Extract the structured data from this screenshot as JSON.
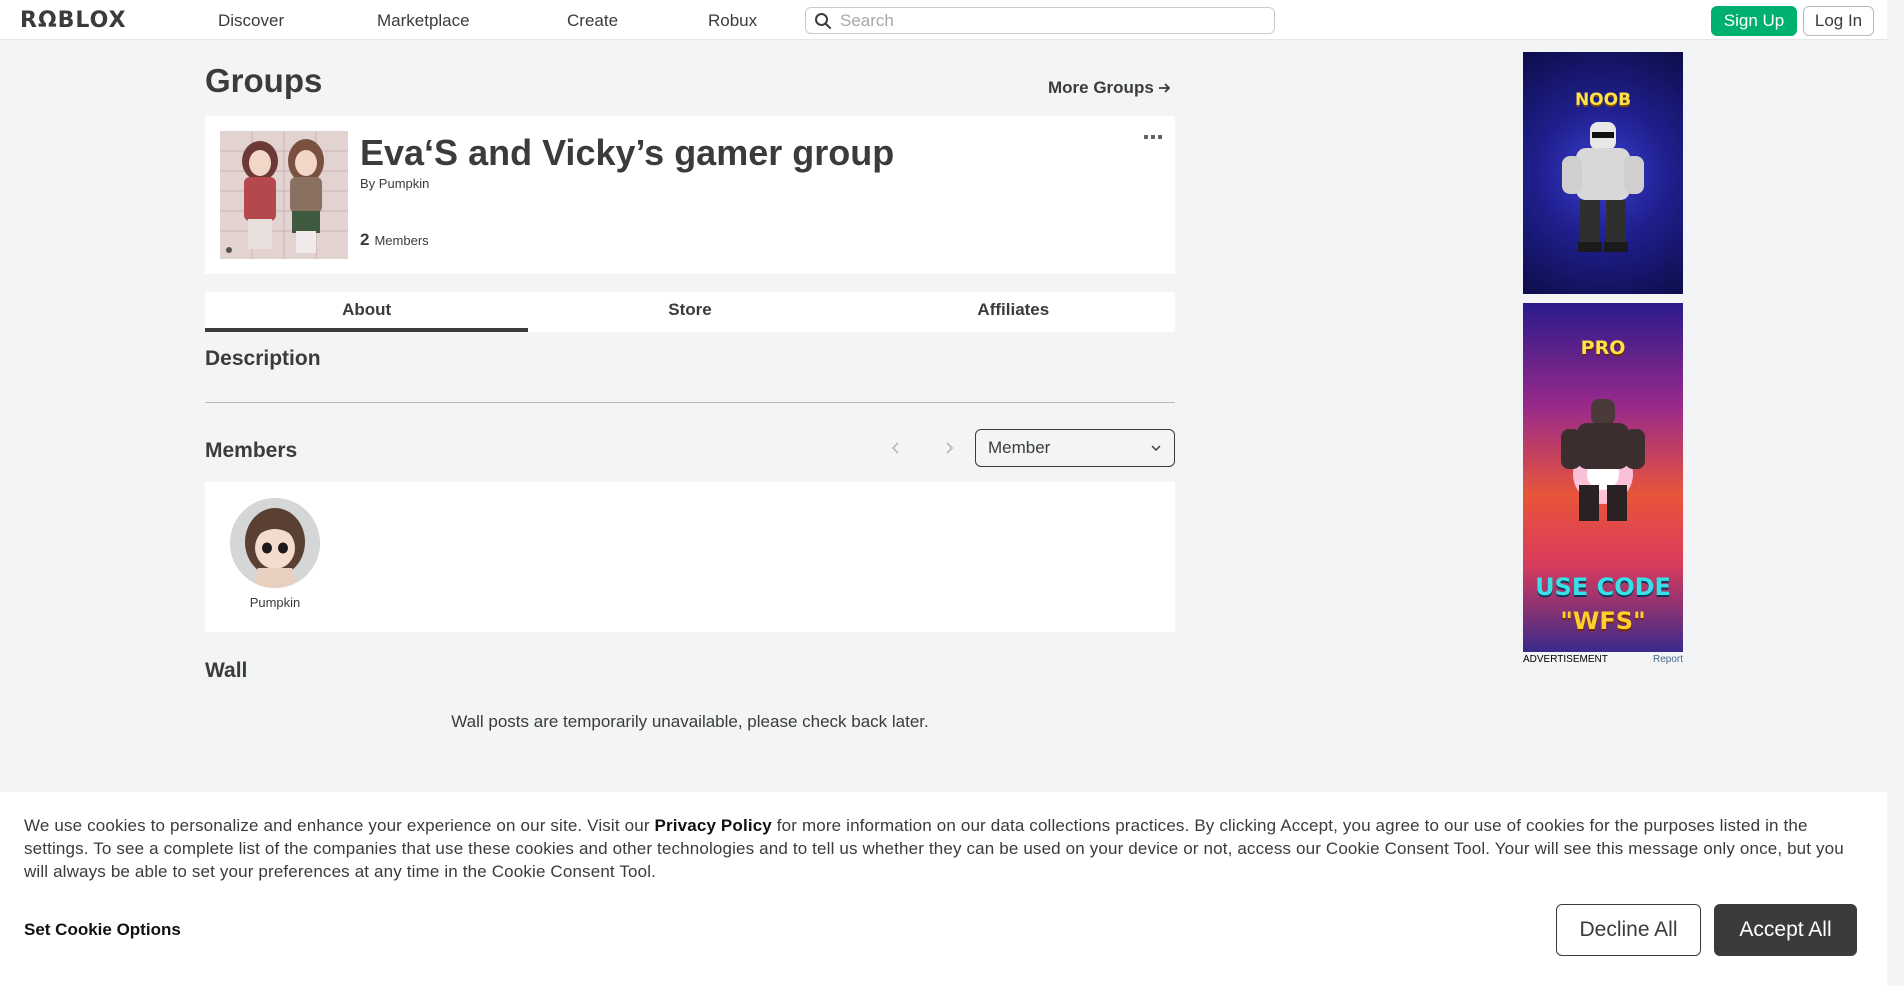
{
  "nav": {
    "logo": "RΩBLOX",
    "links": [
      "Discover",
      "Marketplace",
      "Create",
      "Robux"
    ],
    "search_placeholder": "Search",
    "signup_label": "Sign Up",
    "login_label": "Log In"
  },
  "page": {
    "title": "Groups",
    "more_groups_label": "More Groups"
  },
  "group": {
    "name": "Eva‘S and Vicky’s gamer group",
    "by_label": "By",
    "owner": "Pumpkin",
    "member_count": "2",
    "members_label": "Members"
  },
  "tabs": [
    {
      "label": "About",
      "active": true
    },
    {
      "label": "Store",
      "active": false
    },
    {
      "label": "Affiliates",
      "active": false
    }
  ],
  "description": {
    "title": "Description"
  },
  "members": {
    "title": "Members",
    "role_selected": "Member",
    "list": [
      {
        "name": "Pumpkin"
      }
    ]
  },
  "wall": {
    "title": "Wall",
    "message": "Wall posts are temporarily unavailable, please check back later."
  },
  "ads": {
    "ad1_text": "NOOB",
    "ad2_text_top": "PRO",
    "ad2_text_line1": "USE CODE",
    "ad2_text_line2": "\"WFS\"",
    "caption": "ADVERTISEMENT",
    "report": "Report"
  },
  "cookie": {
    "text_before_link": "We use cookies to personalize and enhance your experience on our site. Visit our ",
    "privacy_link": "Privacy Policy",
    "text_after_link": " for more information on our data collections practices. By clicking Accept, you agree to our use of cookies for the purposes listed in the settings. To see a complete list of the companies that use these cookies and other technologies and to tell us whether they can be used on your device or not, access our Cookie Consent Tool. Your will see this message only once, but you will always be able to set your preferences at any time in the Cookie Consent Tool.",
    "set_options": "Set Cookie Options",
    "decline": "Decline All",
    "accept": "Accept All"
  },
  "colors": {
    "accent_green": "#00b06f",
    "text_dark": "#393b3d",
    "page_bg": "#f2f4f5"
  }
}
